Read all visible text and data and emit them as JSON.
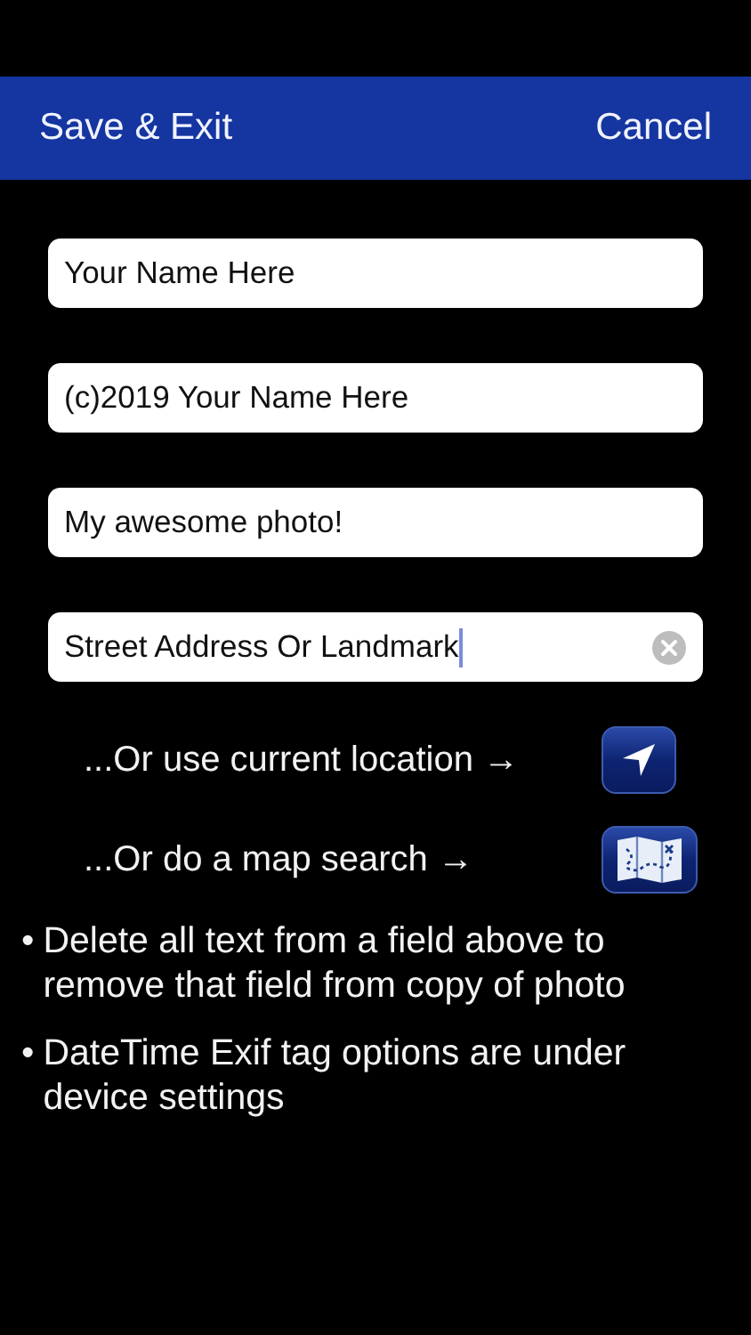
{
  "nav_bar": {
    "left_button": "Save & Exit",
    "right_button": "Cancel"
  },
  "fields": [
    {
      "value": "Your Name Here",
      "focused": false
    },
    {
      "value": "(c)2019 Your Name Here",
      "focused": false
    },
    {
      "value": "My awesome photo!",
      "focused": false
    },
    {
      "value": "Street Address Or Landmark",
      "focused": true
    }
  ],
  "location_options": [
    {
      "label": "...Or use current location →",
      "kind": "location"
    },
    {
      "label": "...Or do a map search →",
      "kind": "map"
    }
  ],
  "notes": [
    {
      "bullet": "•",
      "text": "Delete all text from a field above to remove that field from copy of photo"
    },
    {
      "bullet": "•",
      "text": "DateTime Exif tag options are under device settings"
    }
  ]
}
